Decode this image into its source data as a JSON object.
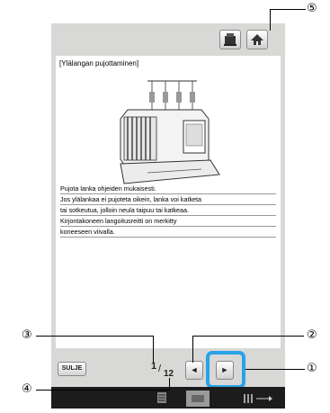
{
  "document": {
    "title": "[Ylälangan pujottaminen]",
    "lines": [
      "Pujota lanka ohjeiden mukaisesti.",
      "Jos ylälankaa ei pujoteta oikein, lanka voi katketa",
      "tai sotkeutua, jolloin neula taipuu tai katkeaa.",
      "Kirjontakoneen langoitusreitti on merkitty",
      "koneeseen viivalla."
    ]
  },
  "buttons": {
    "close_label": "SULJE",
    "prev_icon": "◄",
    "next_icon": "►"
  },
  "pager": {
    "current": "1",
    "sep": "/",
    "total": "12"
  },
  "callouts": {
    "c1": "①",
    "c2": "②",
    "c3": "③",
    "c4": "④",
    "c5": "⑤"
  },
  "colors": {
    "highlight": "#2aa3e6",
    "panel": "#d8d8d6"
  }
}
